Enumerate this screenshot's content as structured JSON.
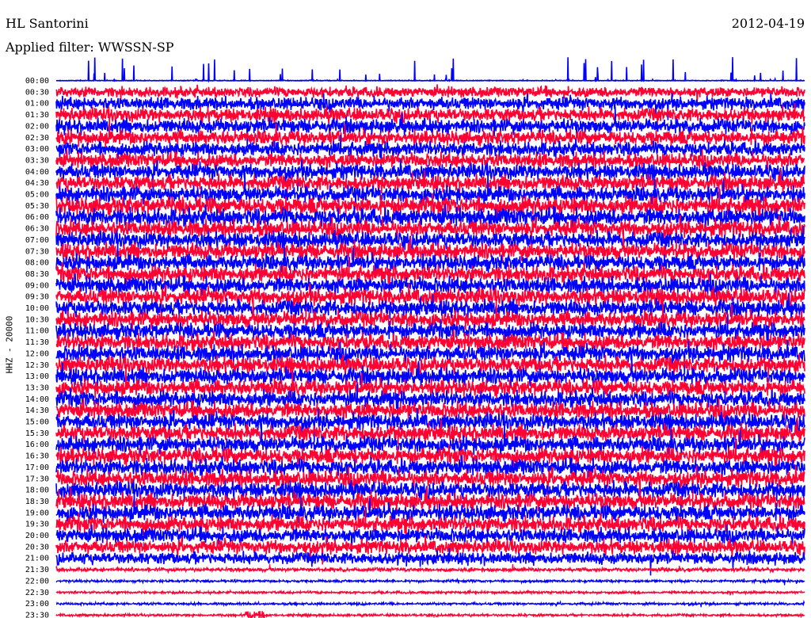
{
  "header": {
    "station": "HL Santorini",
    "date": "2012-04-19",
    "filter": "Applied filter: WWSSN-SP"
  },
  "chart_data": {
    "type": "line",
    "title": "HL Santorini",
    "ylabel": "HHZ - 20000",
    "categories": [
      "00:00",
      "00:30",
      "01:00",
      "01:30",
      "02:00",
      "02:30",
      "03:00",
      "03:30",
      "04:00",
      "04:30",
      "05:00",
      "05:30",
      "06:00",
      "06:30",
      "07:00",
      "07:30",
      "08:00",
      "08:30",
      "09:00",
      "09:30",
      "10:00",
      "10:30",
      "11:00",
      "11:30",
      "12:00",
      "12:30",
      "13:00",
      "13:30",
      "14:00",
      "14:30",
      "15:00",
      "15:30",
      "16:00",
      "16:30",
      "17:00",
      "17:30",
      "18:00",
      "18:30",
      "19:00",
      "19:30",
      "20:00",
      "20:30",
      "21:00",
      "21:30",
      "22:00",
      "22:30",
      "23:00",
      "23:30"
    ],
    "trace_colors": [
      "#0000ff",
      "#ff0033"
    ],
    "relative_amplitude": [
      0.15,
      1.3,
      1.6,
      1.7,
      1.8,
      1.8,
      1.8,
      1.8,
      1.9,
      1.9,
      2.0,
      2.2,
      2.2,
      2.0,
      2.0,
      2.0,
      2.0,
      2.0,
      2.0,
      2.0,
      2.0,
      2.0,
      2.0,
      2.0,
      2.0,
      2.0,
      2.0,
      2.0,
      2.0,
      2.0,
      2.0,
      2.0,
      2.0,
      2.0,
      2.0,
      2.0,
      2.0,
      2.0,
      2.0,
      1.9,
      1.8,
      1.7,
      1.5,
      0.5,
      0.32,
      0.32,
      0.32,
      0.32
    ],
    "grid": false
  }
}
